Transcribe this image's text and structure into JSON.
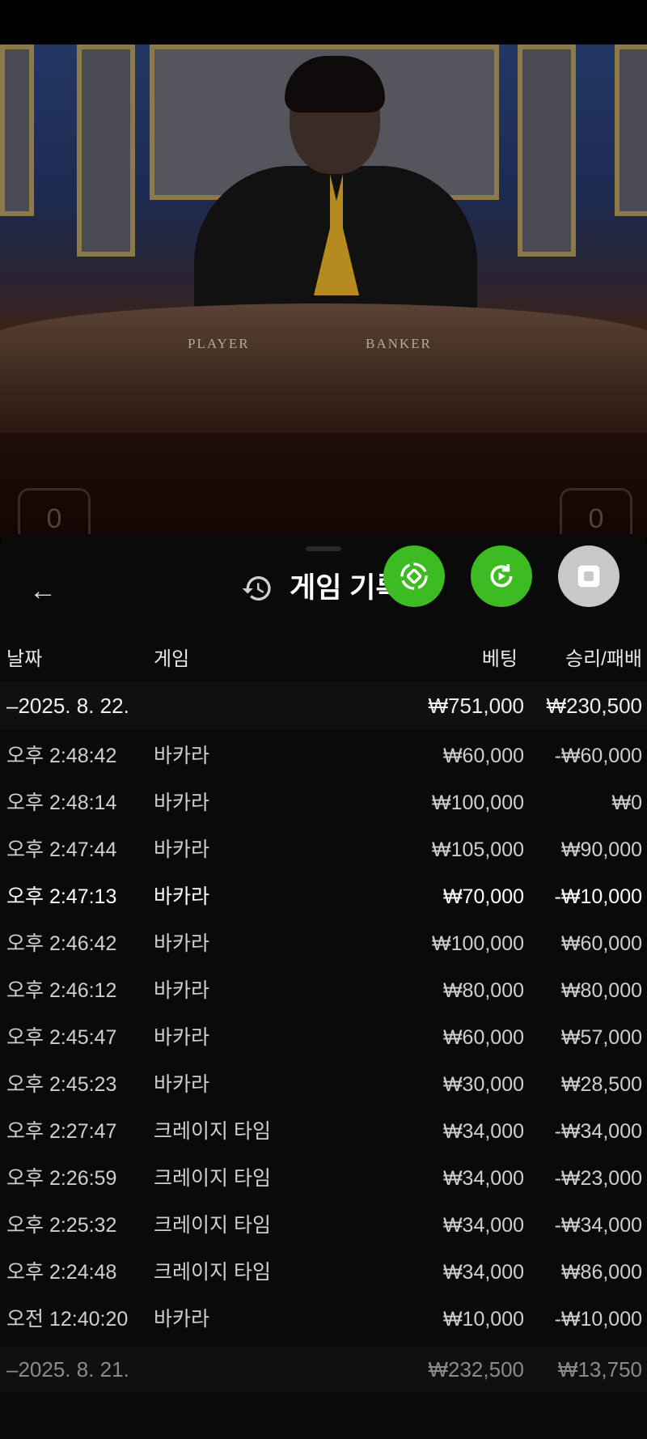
{
  "header": {
    "title": "게임 기록",
    "back_glyph": "←"
  },
  "video": {
    "table_labels": [
      "PLAYER",
      "BANKER"
    ],
    "seat_numbers": [
      "0",
      "0"
    ]
  },
  "columns": {
    "time": "날짜",
    "game": "게임",
    "bet": "베팅",
    "win_loss": "승리/패배"
  },
  "groups": [
    {
      "date": "–2025. 8. 22.",
      "total_bet": "₩751,000",
      "total_win_loss": "₩230,500",
      "rows": [
        {
          "time": "오후 2:48:42",
          "game": "바카라",
          "bet": "₩60,000",
          "win_loss": "-₩60,000"
        },
        {
          "time": "오후 2:48:14",
          "game": "바카라",
          "bet": "₩100,000",
          "win_loss": "₩0"
        },
        {
          "time": "오후 2:47:44",
          "game": "바카라",
          "bet": "₩105,000",
          "win_loss": "₩90,000"
        },
        {
          "time": "오후 2:47:13",
          "game": "바카라",
          "bet": "₩70,000",
          "win_loss": "-₩10,000"
        },
        {
          "time": "오후 2:46:42",
          "game": "바카라",
          "bet": "₩100,000",
          "win_loss": "₩60,000"
        },
        {
          "time": "오후 2:46:12",
          "game": "바카라",
          "bet": "₩80,000",
          "win_loss": "₩80,000"
        },
        {
          "time": "오후 2:45:47",
          "game": "바카라",
          "bet": "₩60,000",
          "win_loss": "₩57,000"
        },
        {
          "time": "오후 2:45:23",
          "game": "바카라",
          "bet": "₩30,000",
          "win_loss": "₩28,500"
        },
        {
          "time": "오후 2:27:47",
          "game": "크레이지 타임",
          "bet": "₩34,000",
          "win_loss": "-₩34,000"
        },
        {
          "time": "오후 2:26:59",
          "game": "크레이지 타임",
          "bet": "₩34,000",
          "win_loss": "-₩23,000"
        },
        {
          "time": "오후 2:25:32",
          "game": "크레이지 타임",
          "bet": "₩34,000",
          "win_loss": "-₩34,000"
        },
        {
          "time": "오후 2:24:48",
          "game": "크레이지 타임",
          "bet": "₩34,000",
          "win_loss": "₩86,000"
        },
        {
          "time": "오전 12:40:20",
          "game": "바카라",
          "bet": "₩10,000",
          "win_loss": "-₩10,000"
        }
      ]
    },
    {
      "date": "–2025. 8. 21.",
      "total_bet": "₩232,500",
      "total_win_loss": "₩13,750",
      "rows": []
    }
  ],
  "colors": {
    "sheet_bg": "#0a0a0a",
    "fab_green": "#3dbb22",
    "fab_gray": "#c8c8c8"
  },
  "icons": [
    "back-arrow-icon",
    "history-icon",
    "rotate-icon",
    "replay-icon",
    "stop-icon"
  ]
}
